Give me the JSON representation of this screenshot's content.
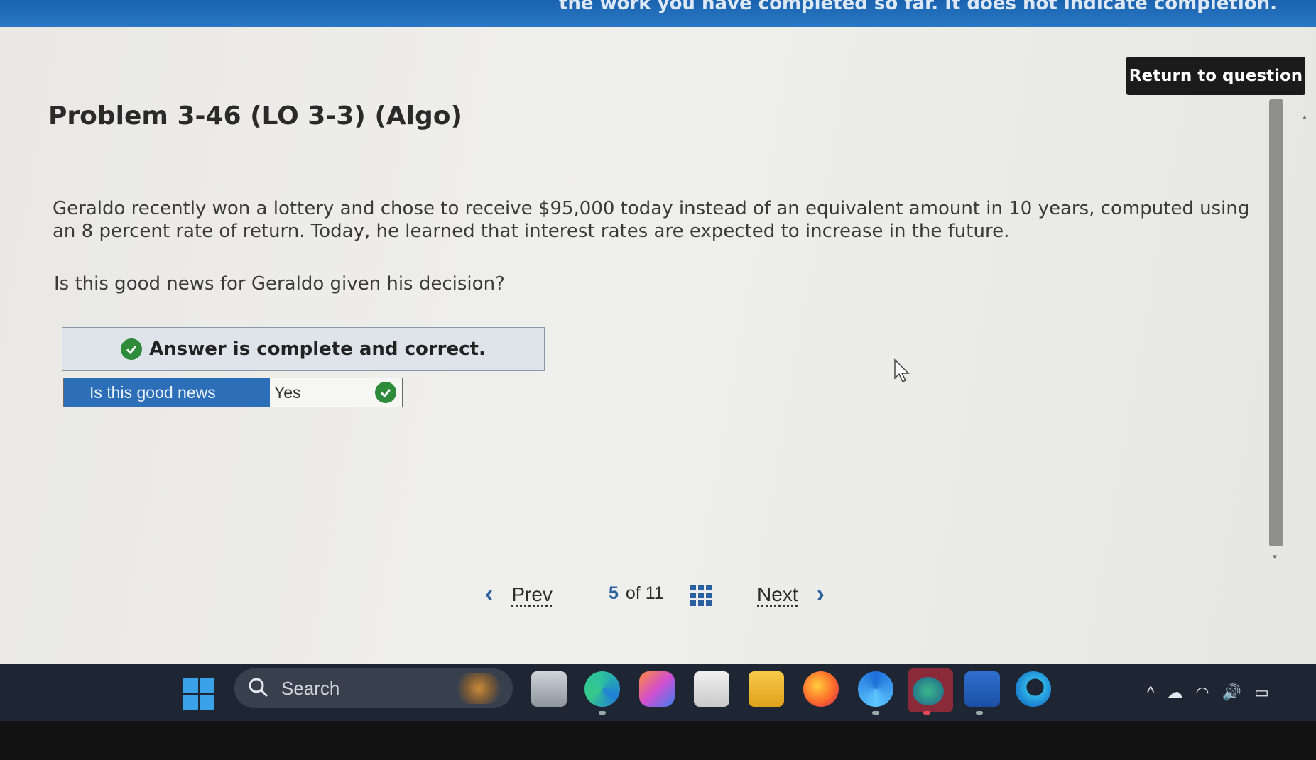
{
  "banner": {
    "text": "the work you have completed so far. It does not indicate completion."
  },
  "header": {
    "return_button": "Return to question"
  },
  "problem": {
    "title": "Problem 3-46 (LO 3-3) (Algo)",
    "paragraph": "Geraldo recently won a lottery and chose to receive $95,000 today instead of an equivalent amount in 10 years, computed using an 8 percent rate of return. Today, he learned that interest rates are expected to increase in the future.",
    "question": "Is this good news for Geraldo given his decision?"
  },
  "answer": {
    "status": "Answer is complete and correct.",
    "row_label": "Is this good news",
    "row_value": "Yes"
  },
  "pager": {
    "prev": "Prev",
    "current": "5",
    "of": "of",
    "total": "11",
    "next": "Next"
  },
  "taskbar": {
    "search_label": "Search",
    "apps": [
      "task-view-icon",
      "edge-icon",
      "copilot-icon",
      "store-icon",
      "file-explorer-icon",
      "firefox-icon",
      "snipping-tool-icon",
      "photos-icon",
      "word-icon",
      "app-icon"
    ]
  },
  "colors": {
    "accent_blue": "#2c6fb8",
    "correct_green": "#2e8b3a",
    "taskbar": "#1f2633"
  }
}
